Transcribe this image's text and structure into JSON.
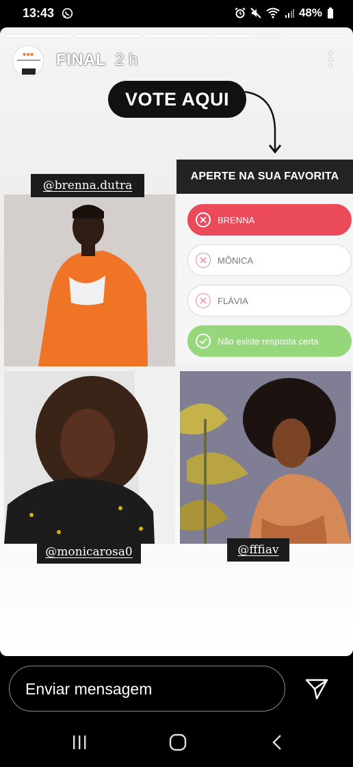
{
  "status_bar": {
    "time": "13:43",
    "battery": "48%"
  },
  "story": {
    "username": "FINAL",
    "time_ago": "2 h",
    "vote_label": "VOTE AQUI",
    "handles": {
      "brenna": "@brenna.dutra",
      "monica": "@monicarosa0",
      "flavia": "@fffiav"
    },
    "poll": {
      "question": "APERTE NA SUA FAVORITA",
      "options": [
        {
          "label": "BRENNA",
          "state": "selected"
        },
        {
          "label": "MÔNICA",
          "state": "incorrect"
        },
        {
          "label": "FLÁVIA",
          "state": "incorrect"
        },
        {
          "label": "Não existe resposta certa",
          "state": "correct"
        }
      ]
    }
  },
  "reply": {
    "message_placeholder": "Enviar mensagem"
  },
  "colors": {
    "selected_option": "#ea4a5a",
    "correct_option": "#96d77c",
    "poll_header": "#232323"
  }
}
